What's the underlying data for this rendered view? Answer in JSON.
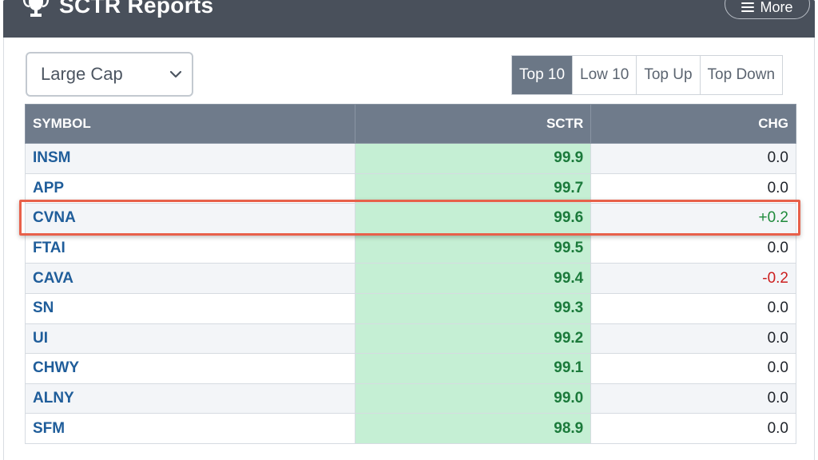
{
  "header": {
    "title": "SCTR Reports",
    "icon": "trophy-icon",
    "more_label": "More"
  },
  "filter": {
    "selected": "Large Cap"
  },
  "tabs": [
    {
      "label": "Top 10",
      "active": true
    },
    {
      "label": "Low 10",
      "active": false
    },
    {
      "label": "Top Up",
      "active": false
    },
    {
      "label": "Top Down",
      "active": false
    }
  ],
  "table": {
    "columns": [
      "SYMBOL",
      "SCTR",
      "CHG"
    ],
    "rows": [
      {
        "symbol": "INSM",
        "sctr": "99.9",
        "chg": "0.0",
        "dir": "flat"
      },
      {
        "symbol": "APP",
        "sctr": "99.7",
        "chg": "0.0",
        "dir": "flat"
      },
      {
        "symbol": "CVNA",
        "sctr": "99.6",
        "chg": "+0.2",
        "dir": "up"
      },
      {
        "symbol": "FTAI",
        "sctr": "99.5",
        "chg": "0.0",
        "dir": "flat"
      },
      {
        "symbol": "CAVA",
        "sctr": "99.4",
        "chg": "-0.2",
        "dir": "down"
      },
      {
        "symbol": "SN",
        "sctr": "99.3",
        "chg": "0.0",
        "dir": "flat"
      },
      {
        "symbol": "UI",
        "sctr": "99.2",
        "chg": "0.0",
        "dir": "flat"
      },
      {
        "symbol": "CHWY",
        "sctr": "99.1",
        "chg": "0.0",
        "dir": "flat"
      },
      {
        "symbol": "ALNY",
        "sctr": "99.0",
        "chg": "0.0",
        "dir": "flat"
      },
      {
        "symbol": "SFM",
        "sctr": "98.9",
        "chg": "0.0",
        "dir": "flat"
      }
    ]
  },
  "colors": {
    "header_bg": "#49505b",
    "active_tab": "#6b7786",
    "sctr_cell": "#c5efd4",
    "positive": "#1f8a3b",
    "negative": "#cc1f1f",
    "highlight": "#e8604a"
  }
}
